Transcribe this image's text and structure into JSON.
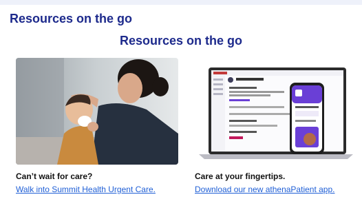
{
  "header": {
    "title_top": "Resources on the go",
    "title_center": "Resources on the go"
  },
  "cards": [
    {
      "title": "Can’t wait for care?",
      "link": "Walk into Summit Health Urgent Care.",
      "image": "mother-and-child-photo"
    },
    {
      "title": "Care at your fingertips.",
      "link": "Download our new athenaPatient app.",
      "image": "laptop-and-phone-app-screenshot"
    }
  ],
  "colors": {
    "heading": "#1d2a8c",
    "link": "#1f5fd6",
    "app_accent": "#6a3fd6"
  }
}
